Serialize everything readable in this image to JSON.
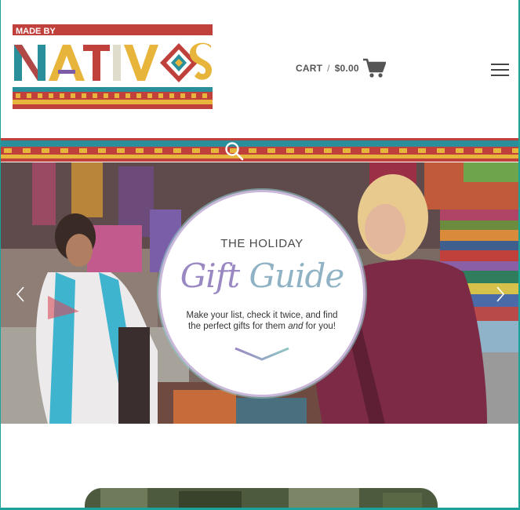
{
  "brand": {
    "name_small": "MADE BY",
    "name_large": "NATIVOS",
    "colors": {
      "red": "#c0403c",
      "teal": "#2a8f9a",
      "yellow": "#e8b53c",
      "purple": "#7d5ba6"
    }
  },
  "header": {
    "cart_label": "CART",
    "cart_separator": "/",
    "cart_amount": "$0.00"
  },
  "hero": {
    "eyebrow": "THE HOLIDAY",
    "title_part1": "Gift ",
    "title_part2": "Guide",
    "copy_line1": "Make your list, check it twice, and find",
    "copy_line2_a": "the perfect gifts for them ",
    "copy_line2_em": "and",
    "copy_line2_b": " for you!"
  },
  "icons": {
    "cart": "shopping-cart-icon",
    "menu": "hamburger-menu-icon",
    "search": "search-icon",
    "prev": "chevron-left-icon",
    "next": "chevron-right-icon"
  }
}
